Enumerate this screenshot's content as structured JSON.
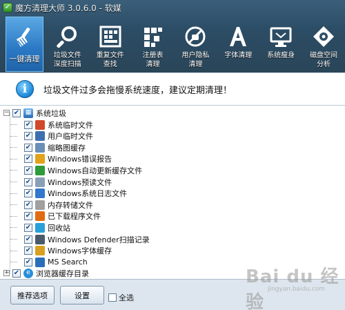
{
  "window": {
    "title": "魔方清理大师 3.0.6.0 - 软媒"
  },
  "toolbar": {
    "items": [
      {
        "label": "一键清理",
        "icon": "broom-icon"
      },
      {
        "label": "垃圾文件\n深度扫描",
        "icon": "magnifier-icon"
      },
      {
        "label": "重复文件\n查找",
        "icon": "grid-icon"
      },
      {
        "label": "注册表\n清理",
        "icon": "blocks-icon"
      },
      {
        "label": "用户隐私\n清理",
        "icon": "privacy-icon"
      },
      {
        "label": "字体清理",
        "icon": "font-a-icon"
      },
      {
        "label": "系统瘦身",
        "icon": "monitor-icon"
      },
      {
        "label": "磁盘空间\n分析",
        "icon": "disk-icon"
      }
    ]
  },
  "banner": {
    "text": "垃圾文件过多会拖慢系统速度，建议定期清理！"
  },
  "tree": {
    "root": {
      "label": "系统垃圾",
      "expander": "−",
      "checked": "✔"
    },
    "children": [
      {
        "label": "系统临时文件",
        "icon": "windows-flag-icon",
        "color": "#d04a2a"
      },
      {
        "label": "用户临时文件",
        "icon": "user-folder-icon",
        "color": "#3d6fb0"
      },
      {
        "label": "缩略图缓存",
        "icon": "thumbnail-icon",
        "color": "#6a8fb8"
      },
      {
        "label": "Windows错误报告",
        "icon": "error-report-icon",
        "color": "#e2a21a"
      },
      {
        "label": "Windows自动更新缓存文件",
        "icon": "update-icon",
        "color": "#2f9a3a"
      },
      {
        "label": "Windows预读文件",
        "icon": "prefetch-icon",
        "color": "#8aa0b8"
      },
      {
        "label": "Windows系统日志文件",
        "icon": "log-icon",
        "color": "#3377cc"
      },
      {
        "label": "内存转储文件",
        "icon": "memory-dump-icon",
        "color": "#a0a0a0"
      },
      {
        "label": "已下载程序文件",
        "icon": "download-icon",
        "color": "#e06b12"
      },
      {
        "label": "回收站",
        "icon": "recycle-icon",
        "color": "#2aa0d8"
      },
      {
        "label": "Windows Defender扫描记录",
        "icon": "defender-icon",
        "color": "#4a5a6a"
      },
      {
        "label": "Windows字体缓存",
        "icon": "font-cache-icon",
        "color": "#d8a020"
      },
      {
        "label": "MS Search",
        "icon": "search-icon",
        "color": "#2a6fb8"
      }
    ],
    "second_root": {
      "label": "浏览器缓存目录",
      "expander": "+",
      "checked": "✔"
    }
  },
  "footer": {
    "recommend_label": "推荐选项",
    "settings_label": "设置",
    "select_all_label": "全选"
  },
  "watermark": {
    "main": "Bai du 经验",
    "sub": "jingyan.baidu.com"
  },
  "colors": {
    "accent": "#2a78c4",
    "toolbar_bg": "#2c4d66"
  }
}
